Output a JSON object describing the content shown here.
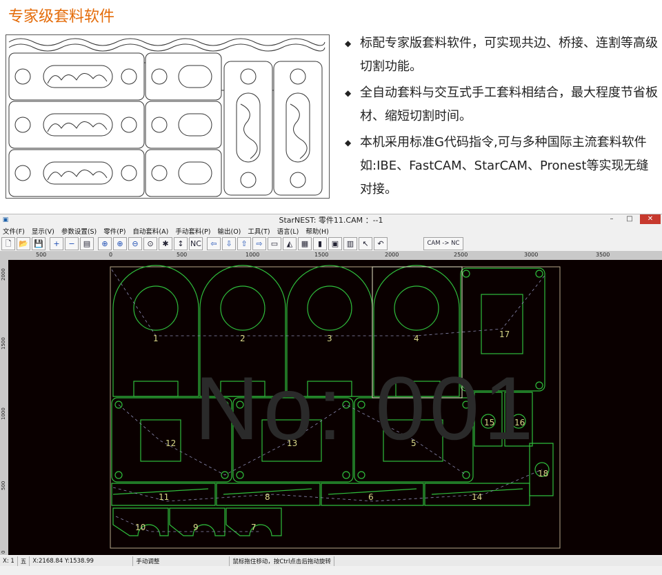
{
  "heading": "专家级套料软件",
  "bullets": [
    "标配专家版套料软件，可实现共边、桥接、连割等高级切割功能。",
    "全自动套料与交互式手工套料相结合，最大程度节省板材、缩短切割时间。",
    "本机采用标准G代码指令,可与多种国际主流套料软件如:IBE、FastCAM、StarCAM、Pronest等实现无缝对接。"
  ],
  "window": {
    "title": "StarNEST: 零件11.CAM ：--1",
    "app_icon": "starnest-app-icon",
    "min": "–",
    "restore": "□",
    "close": "✕"
  },
  "menu": [
    "文件(F)",
    "显示(V)",
    "参数设置(S)",
    "零件(P)",
    "自动套料(A)",
    "手动套料(P)",
    "输出(O)",
    "工具(T)",
    "语言(L)",
    "帮助(H)"
  ],
  "toolbar": {
    "icons": [
      "new-file-icon",
      "open-folder-icon",
      "save-icon",
      "add-icon",
      "remove-icon",
      "table-icon",
      "zoom-window-icon",
      "zoom-in-icon",
      "zoom-out-icon",
      "zoom-fit-icon",
      "redraw-icon",
      "sort-icon",
      "nc-icon",
      "move-left-icon",
      "move-down-icon",
      "move-up-icon",
      "move-right-icon",
      "measure-icon",
      "rotate-icon",
      "grid-icon",
      "align-icon",
      "stack-icon",
      "bars-icon",
      "pointer-icon",
      "undo-icon"
    ],
    "glyphs": [
      "🗋",
      "📂",
      "💾",
      "+",
      "−",
      "▤",
      "⊕",
      "⊕",
      "⊖",
      "⊙",
      "✱",
      "↕",
      "NC",
      "⇦",
      "⇩",
      "⇧",
      "⇨",
      "▭",
      "◭",
      "▦",
      "▮",
      "▣",
      "▥",
      "↖",
      "↶"
    ],
    "cam_nc": "CAM -> NC"
  },
  "ruler": {
    "h_ticks": [
      "500",
      "0",
      "500",
      "1000",
      "1500",
      "2000",
      "2500",
      "3000",
      "3500"
    ],
    "v_ticks": [
      "2000",
      "1500",
      "1000",
      "500",
      "0"
    ]
  },
  "canvas": {
    "watermark": "No: 001",
    "part_labels": [
      "1",
      "2",
      "3",
      "4",
      "17",
      "12",
      "13",
      "5",
      "15",
      "16",
      "18",
      "11",
      "8",
      "6",
      "14",
      "10",
      "9",
      "7"
    ],
    "colors": {
      "part": "#2fbf3c",
      "sheet": "#b5a88a",
      "selection": "#e8e8c8",
      "dash": "#8d8db5",
      "label": "#d9d98a"
    }
  },
  "status": {
    "xpos": "X: 1",
    "icons_text": "五",
    "coord": "X:2168.84 Y:1538.99",
    "mode": "手动调整",
    "hint": "鼠标拖住移动，按Ctrl点击后拖动旋转"
  }
}
